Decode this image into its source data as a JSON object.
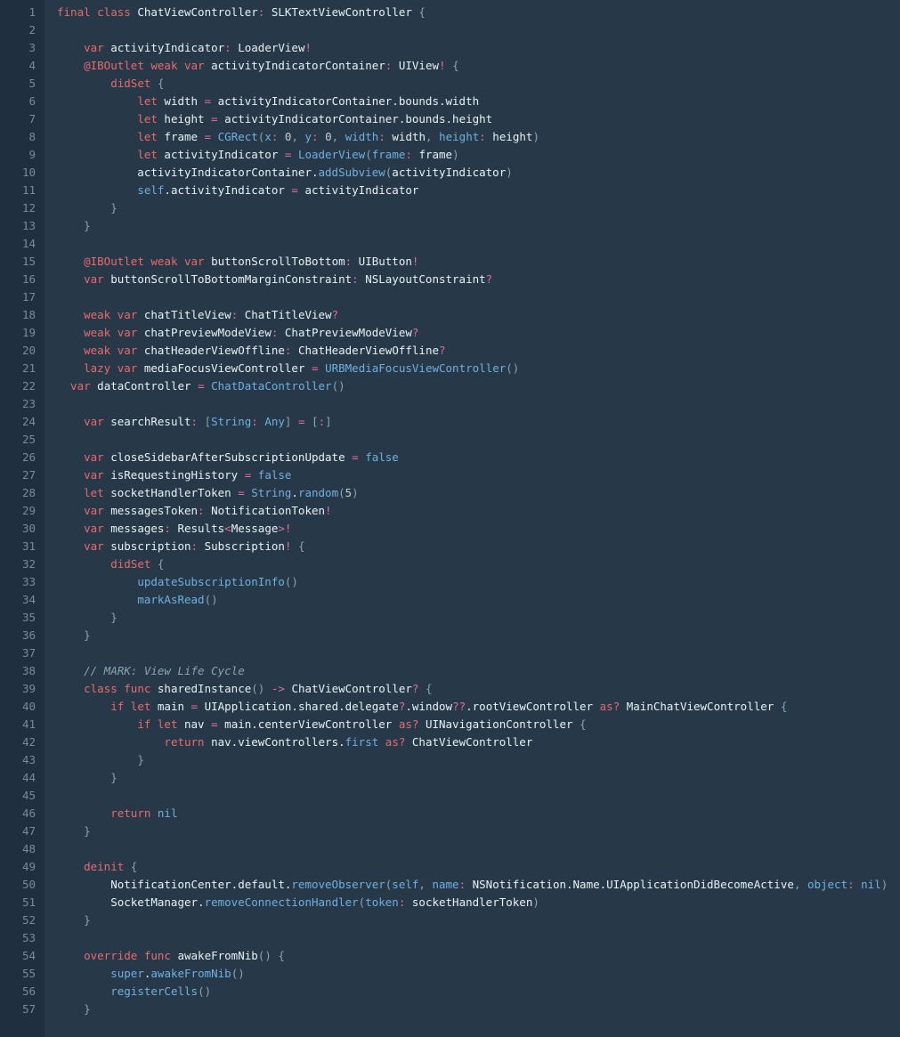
{
  "editor": {
    "lineStart": 1,
    "lineEnd": 57,
    "lines": [
      [
        [
          "kw-red",
          "final class"
        ],
        [
          "ident",
          " ChatViewController"
        ],
        [
          "op",
          ":"
        ],
        [
          "ident",
          " SLKTextViewController "
        ],
        [
          "punct",
          "{"
        ]
      ],
      [],
      [
        [
          "ident",
          "    "
        ],
        [
          "kw-red",
          "var"
        ],
        [
          "ident",
          " activityIndicator"
        ],
        [
          "op",
          ":"
        ],
        [
          "ident",
          " LoaderView"
        ],
        [
          "op",
          "!"
        ]
      ],
      [
        [
          "ident",
          "    "
        ],
        [
          "kw-red",
          "@IBOutlet weak var"
        ],
        [
          "ident",
          " activityIndicatorContainer"
        ],
        [
          "op",
          ":"
        ],
        [
          "ident",
          " UIView"
        ],
        [
          "op",
          "!"
        ],
        [
          "ident",
          " "
        ],
        [
          "punct",
          "{"
        ]
      ],
      [
        [
          "ident",
          "        "
        ],
        [
          "kw-red",
          "didSet"
        ],
        [
          "ident",
          " "
        ],
        [
          "punct",
          "{"
        ]
      ],
      [
        [
          "ident",
          "            "
        ],
        [
          "kw-red",
          "let"
        ],
        [
          "ident",
          " width "
        ],
        [
          "op",
          "="
        ],
        [
          "ident",
          " activityIndicatorContainer.bounds.width"
        ]
      ],
      [
        [
          "ident",
          "            "
        ],
        [
          "kw-red",
          "let"
        ],
        [
          "ident",
          " height "
        ],
        [
          "op",
          "="
        ],
        [
          "ident",
          " activityIndicatorContainer.bounds.height"
        ]
      ],
      [
        [
          "ident",
          "            "
        ],
        [
          "kw-red",
          "let"
        ],
        [
          "ident",
          " frame "
        ],
        [
          "op",
          "="
        ],
        [
          "ident",
          " "
        ],
        [
          "fn-call",
          "CGRect"
        ],
        [
          "punct",
          "("
        ],
        [
          "kw-blue",
          "x"
        ],
        [
          "op",
          ":"
        ],
        [
          "ident",
          " "
        ],
        [
          "num",
          "0"
        ],
        [
          "punct",
          ", "
        ],
        [
          "kw-blue",
          "y"
        ],
        [
          "op",
          ":"
        ],
        [
          "ident",
          " "
        ],
        [
          "num",
          "0"
        ],
        [
          "punct",
          ", "
        ],
        [
          "kw-blue",
          "width"
        ],
        [
          "op",
          ":"
        ],
        [
          "ident",
          " width"
        ],
        [
          "punct",
          ", "
        ],
        [
          "kw-blue",
          "height"
        ],
        [
          "op",
          ":"
        ],
        [
          "ident",
          " height"
        ],
        [
          "punct",
          ")"
        ]
      ],
      [
        [
          "ident",
          "            "
        ],
        [
          "kw-red",
          "let"
        ],
        [
          "ident",
          " activityIndicator "
        ],
        [
          "op",
          "="
        ],
        [
          "ident",
          " "
        ],
        [
          "fn-call",
          "LoaderView"
        ],
        [
          "punct",
          "("
        ],
        [
          "kw-blue",
          "frame"
        ],
        [
          "op",
          ":"
        ],
        [
          "ident",
          " frame"
        ],
        [
          "punct",
          ")"
        ]
      ],
      [
        [
          "ident",
          "            activityIndicatorContainer."
        ],
        [
          "fn-call",
          "addSubview"
        ],
        [
          "punct",
          "("
        ],
        [
          "ident",
          "activityIndicator"
        ],
        [
          "punct",
          ")"
        ]
      ],
      [
        [
          "ident",
          "            "
        ],
        [
          "kw-blue",
          "self"
        ],
        [
          "ident",
          ".activityIndicator "
        ],
        [
          "op",
          "="
        ],
        [
          "ident",
          " activityIndicator"
        ]
      ],
      [
        [
          "ident",
          "        "
        ],
        [
          "punct",
          "}"
        ]
      ],
      [
        [
          "ident",
          "    "
        ],
        [
          "punct",
          "}"
        ]
      ],
      [],
      [
        [
          "ident",
          "    "
        ],
        [
          "kw-red",
          "@IBOutlet weak var"
        ],
        [
          "ident",
          " buttonScrollToBottom"
        ],
        [
          "op",
          ":"
        ],
        [
          "ident",
          " UIButton"
        ],
        [
          "op",
          "!"
        ]
      ],
      [
        [
          "ident",
          "    "
        ],
        [
          "kw-red",
          "var"
        ],
        [
          "ident",
          " buttonScrollToBottomMarginConstraint"
        ],
        [
          "op",
          ":"
        ],
        [
          "ident",
          " NSLayoutConstraint"
        ],
        [
          "op",
          "?"
        ]
      ],
      [],
      [
        [
          "ident",
          "    "
        ],
        [
          "kw-red",
          "weak var"
        ],
        [
          "ident",
          " chatTitleView"
        ],
        [
          "op",
          ":"
        ],
        [
          "ident",
          " ChatTitleView"
        ],
        [
          "op",
          "?"
        ]
      ],
      [
        [
          "ident",
          "    "
        ],
        [
          "kw-red",
          "weak var"
        ],
        [
          "ident",
          " chatPreviewModeView"
        ],
        [
          "op",
          ":"
        ],
        [
          "ident",
          " ChatPreviewModeView"
        ],
        [
          "op",
          "?"
        ]
      ],
      [
        [
          "ident",
          "    "
        ],
        [
          "kw-red",
          "weak var"
        ],
        [
          "ident",
          " chatHeaderViewOffline"
        ],
        [
          "op",
          ":"
        ],
        [
          "ident",
          " ChatHeaderViewOffline"
        ],
        [
          "op",
          "?"
        ]
      ],
      [
        [
          "ident",
          "    "
        ],
        [
          "kw-red",
          "lazy var"
        ],
        [
          "ident",
          " mediaFocusViewController "
        ],
        [
          "op",
          "="
        ],
        [
          "ident",
          " "
        ],
        [
          "fn-call",
          "URBMediaFocusViewController"
        ],
        [
          "punct",
          "()"
        ]
      ],
      [
        [
          "kw-red",
          "  var"
        ],
        [
          "ident",
          " dataController "
        ],
        [
          "op",
          "="
        ],
        [
          "ident",
          " "
        ],
        [
          "fn-call",
          "ChatDataController"
        ],
        [
          "punct",
          "()"
        ]
      ],
      [],
      [
        [
          "ident",
          "    "
        ],
        [
          "kw-red",
          "var"
        ],
        [
          "ident",
          " searchResult"
        ],
        [
          "op",
          ":"
        ],
        [
          "ident",
          " "
        ],
        [
          "punct",
          "["
        ],
        [
          "kw-blue",
          "String"
        ],
        [
          "op",
          ":"
        ],
        [
          "ident",
          " "
        ],
        [
          "kw-blue",
          "Any"
        ],
        [
          "punct",
          "]"
        ],
        [
          "ident",
          " "
        ],
        [
          "op",
          "="
        ],
        [
          "ident",
          " "
        ],
        [
          "punct",
          "["
        ],
        [
          "op",
          ":"
        ],
        [
          "punct",
          "]"
        ]
      ],
      [],
      [
        [
          "ident",
          "    "
        ],
        [
          "kw-red",
          "var"
        ],
        [
          "ident",
          " closeSidebarAfterSubscriptionUpdate "
        ],
        [
          "op",
          "="
        ],
        [
          "ident",
          " "
        ],
        [
          "kw-blue",
          "false"
        ]
      ],
      [
        [
          "ident",
          "    "
        ],
        [
          "kw-red",
          "var"
        ],
        [
          "ident",
          " isRequestingHistory "
        ],
        [
          "op",
          "="
        ],
        [
          "ident",
          " "
        ],
        [
          "kw-blue",
          "false"
        ]
      ],
      [
        [
          "ident",
          "    "
        ],
        [
          "kw-red",
          "let"
        ],
        [
          "ident",
          " socketHandlerToken "
        ],
        [
          "op",
          "="
        ],
        [
          "ident",
          " "
        ],
        [
          "kw-blue",
          "String"
        ],
        [
          "ident",
          "."
        ],
        [
          "fn-call",
          "random"
        ],
        [
          "punct",
          "("
        ],
        [
          "num",
          "5"
        ],
        [
          "punct",
          ")"
        ]
      ],
      [
        [
          "ident",
          "    "
        ],
        [
          "kw-red",
          "var"
        ],
        [
          "ident",
          " messagesToken"
        ],
        [
          "op",
          ":"
        ],
        [
          "ident",
          " NotificationToken"
        ],
        [
          "op",
          "!"
        ]
      ],
      [
        [
          "ident",
          "    "
        ],
        [
          "kw-red",
          "var"
        ],
        [
          "ident",
          " messages"
        ],
        [
          "op",
          ":"
        ],
        [
          "ident",
          " Results"
        ],
        [
          "op",
          "<"
        ],
        [
          "ident",
          "Message"
        ],
        [
          "op",
          ">!"
        ]
      ],
      [
        [
          "ident",
          "    "
        ],
        [
          "kw-red",
          "var"
        ],
        [
          "ident",
          " subscription"
        ],
        [
          "op",
          ":"
        ],
        [
          "ident",
          " Subscription"
        ],
        [
          "op",
          "!"
        ],
        [
          "ident",
          " "
        ],
        [
          "punct",
          "{"
        ]
      ],
      [
        [
          "ident",
          "        "
        ],
        [
          "kw-red",
          "didSet"
        ],
        [
          "ident",
          " "
        ],
        [
          "punct",
          "{"
        ]
      ],
      [
        [
          "ident",
          "            "
        ],
        [
          "fn-call",
          "updateSubscriptionInfo"
        ],
        [
          "punct",
          "()"
        ]
      ],
      [
        [
          "ident",
          "            "
        ],
        [
          "fn-call",
          "markAsRead"
        ],
        [
          "punct",
          "()"
        ]
      ],
      [
        [
          "ident",
          "        "
        ],
        [
          "punct",
          "}"
        ]
      ],
      [
        [
          "ident",
          "    "
        ],
        [
          "punct",
          "}"
        ]
      ],
      [],
      [
        [
          "ident",
          "    "
        ],
        [
          "comment",
          "// MARK: View Life Cycle"
        ]
      ],
      [
        [
          "ident",
          "    "
        ],
        [
          "kw-red",
          "class func"
        ],
        [
          "ident",
          " sharedInstance"
        ],
        [
          "punct",
          "()"
        ],
        [
          "ident",
          " "
        ],
        [
          "op",
          "->"
        ],
        [
          "ident",
          " ChatViewController"
        ],
        [
          "op",
          "?"
        ],
        [
          "ident",
          " "
        ],
        [
          "punct",
          "{"
        ]
      ],
      [
        [
          "ident",
          "        "
        ],
        [
          "kw-red",
          "if let"
        ],
        [
          "ident",
          " main "
        ],
        [
          "op",
          "="
        ],
        [
          "ident",
          " UIApplication.shared.delegate"
        ],
        [
          "op",
          "?"
        ],
        [
          "ident",
          ".window"
        ],
        [
          "op",
          "??"
        ],
        [
          "ident",
          ".rootViewController "
        ],
        [
          "kw-red",
          "as?"
        ],
        [
          "ident",
          " MainChatViewController "
        ],
        [
          "punct",
          "{"
        ]
      ],
      [
        [
          "ident",
          "            "
        ],
        [
          "kw-red",
          "if let"
        ],
        [
          "ident",
          " nav "
        ],
        [
          "op",
          "="
        ],
        [
          "ident",
          " main.centerViewController "
        ],
        [
          "kw-red",
          "as?"
        ],
        [
          "ident",
          " UINavigationController "
        ],
        [
          "punct",
          "{"
        ]
      ],
      [
        [
          "ident",
          "                "
        ],
        [
          "kw-red",
          "return"
        ],
        [
          "ident",
          " nav.viewControllers."
        ],
        [
          "kw-blue",
          "first"
        ],
        [
          "ident",
          " "
        ],
        [
          "kw-red",
          "as?"
        ],
        [
          "ident",
          " ChatViewController"
        ]
      ],
      [
        [
          "ident",
          "            "
        ],
        [
          "punct",
          "}"
        ]
      ],
      [
        [
          "ident",
          "        "
        ],
        [
          "punct",
          "}"
        ]
      ],
      [],
      [
        [
          "ident",
          "        "
        ],
        [
          "kw-red",
          "return"
        ],
        [
          "ident",
          " "
        ],
        [
          "kw-blue",
          "nil"
        ]
      ],
      [
        [
          "ident",
          "    "
        ],
        [
          "punct",
          "}"
        ]
      ],
      [],
      [
        [
          "ident",
          "    "
        ],
        [
          "kw-red",
          "deinit"
        ],
        [
          "ident",
          " "
        ],
        [
          "punct",
          "{"
        ]
      ],
      [
        [
          "ident",
          "        NotificationCenter.default."
        ],
        [
          "fn-call",
          "removeObserver"
        ],
        [
          "punct",
          "("
        ],
        [
          "kw-blue",
          "self"
        ],
        [
          "punct",
          ", "
        ],
        [
          "kw-blue",
          "name"
        ],
        [
          "op",
          ":"
        ],
        [
          "ident",
          " NSNotification.Name.UIApplicationDidBecomeActive"
        ],
        [
          "punct",
          ", "
        ],
        [
          "kw-blue",
          "object"
        ],
        [
          "op",
          ":"
        ],
        [
          "ident",
          " "
        ],
        [
          "kw-blue",
          "nil"
        ],
        [
          "punct",
          ")"
        ]
      ],
      [
        [
          "ident",
          "        SocketManager."
        ],
        [
          "fn-call",
          "removeConnectionHandler"
        ],
        [
          "punct",
          "("
        ],
        [
          "kw-blue",
          "token"
        ],
        [
          "op",
          ":"
        ],
        [
          "ident",
          " socketHandlerToken"
        ],
        [
          "punct",
          ")"
        ]
      ],
      [
        [
          "ident",
          "    "
        ],
        [
          "punct",
          "}"
        ]
      ],
      [],
      [
        [
          "ident",
          "    "
        ],
        [
          "kw-red",
          "override func"
        ],
        [
          "ident",
          " awakeFromNib"
        ],
        [
          "punct",
          "()"
        ],
        [
          "ident",
          " "
        ],
        [
          "punct",
          "{"
        ]
      ],
      [
        [
          "ident",
          "        "
        ],
        [
          "kw-blue",
          "super"
        ],
        [
          "ident",
          "."
        ],
        [
          "fn-call",
          "awakeFromNib"
        ],
        [
          "punct",
          "()"
        ]
      ],
      [
        [
          "ident",
          "        "
        ],
        [
          "fn-call",
          "registerCells"
        ],
        [
          "punct",
          "()"
        ]
      ],
      [
        [
          "ident",
          "    "
        ],
        [
          "punct",
          "}"
        ]
      ]
    ]
  }
}
